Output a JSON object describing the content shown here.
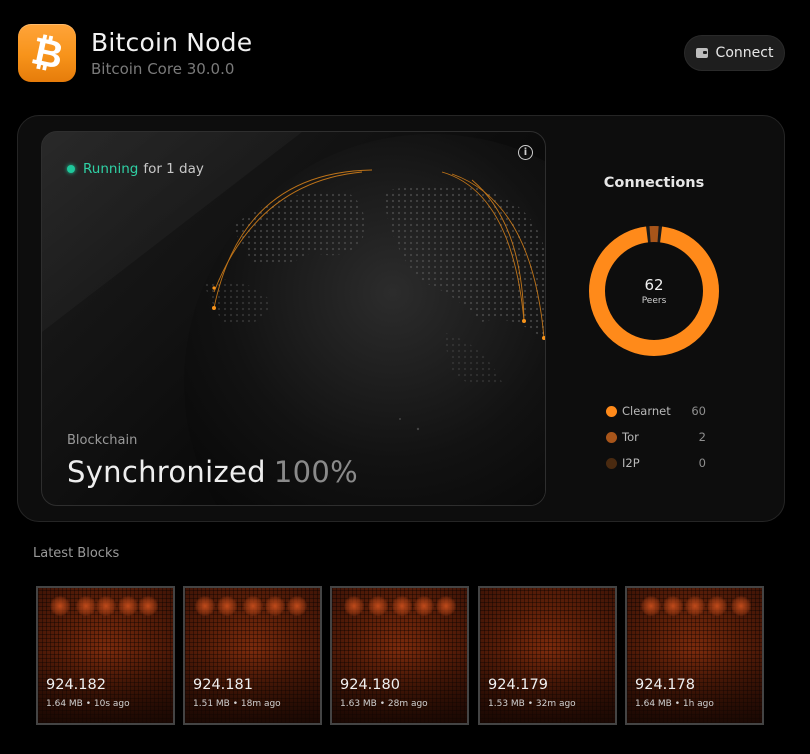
{
  "header": {
    "app_icon": "bitcoin-icon",
    "app_icon_glyph": "₿",
    "title": "Bitcoin Node",
    "subtitle": "Bitcoin Core 30.0.0",
    "connect_label": "Connect",
    "connect_icon": "wallet-icon"
  },
  "node": {
    "status": "Running",
    "uptime": "for 1 day",
    "info_icon": "info-icon",
    "blockchain_label": "Blockchain",
    "sync_state": "Synchronized",
    "sync_percent": "100%"
  },
  "connections": {
    "title": "Connections",
    "total": "62",
    "total_label": "Peers",
    "items": [
      {
        "name": "Clearnet",
        "value": "60",
        "color": "#ff8a1a"
      },
      {
        "name": "Tor",
        "value": "2",
        "color": "#a8551a"
      },
      {
        "name": "I2P",
        "value": "0",
        "color": "#4a2a10"
      }
    ]
  },
  "blocks": {
    "title": "Latest Blocks",
    "items": [
      {
        "height": "924.182",
        "meta": "1.64 MB • 10s ago"
      },
      {
        "height": "924.181",
        "meta": "1.51 MB • 18m ago"
      },
      {
        "height": "924.180",
        "meta": "1.63 MB • 28m ago"
      },
      {
        "height": "924.179",
        "meta": "1.53 MB • 32m ago"
      },
      {
        "height": "924.178",
        "meta": "1.64 MB • 1h ago"
      }
    ]
  },
  "colors": {
    "accent": "#f7931a",
    "status_running": "#2fd1a5"
  }
}
